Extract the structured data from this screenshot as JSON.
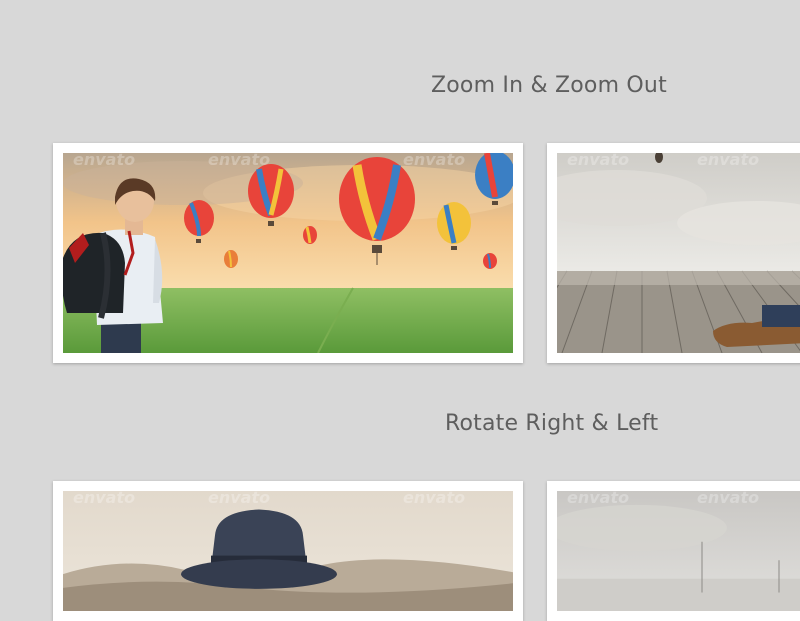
{
  "sections": [
    {
      "title": "Zoom In & Zoom Out"
    },
    {
      "title": "Rotate Right & Left"
    }
  ],
  "watermark": "envato",
  "colors": {
    "background": "#d8d8d8",
    "card": "#ffffff",
    "title_text": "#5e5e5e"
  }
}
